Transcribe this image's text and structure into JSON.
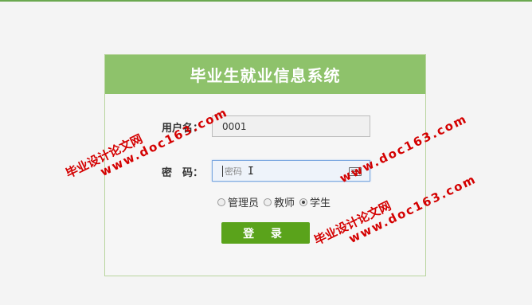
{
  "header": {
    "title": "毕业生就业信息系统"
  },
  "form": {
    "username_label": "用户名：",
    "username_value": "0001",
    "password_label": "密　码：",
    "password_placeholder": "密码",
    "roles": [
      {
        "label": "管理员",
        "checked": false
      },
      {
        "label": "教师",
        "checked": false
      },
      {
        "label": "学生",
        "checked": true
      }
    ],
    "login_label": "登 录"
  },
  "watermarks": {
    "line1": "毕业设计论文网",
    "line2": "www.doc163.com"
  },
  "colors": {
    "accent": "#8ec26b",
    "button": "#5aa31b",
    "watermark": "#d40000"
  }
}
